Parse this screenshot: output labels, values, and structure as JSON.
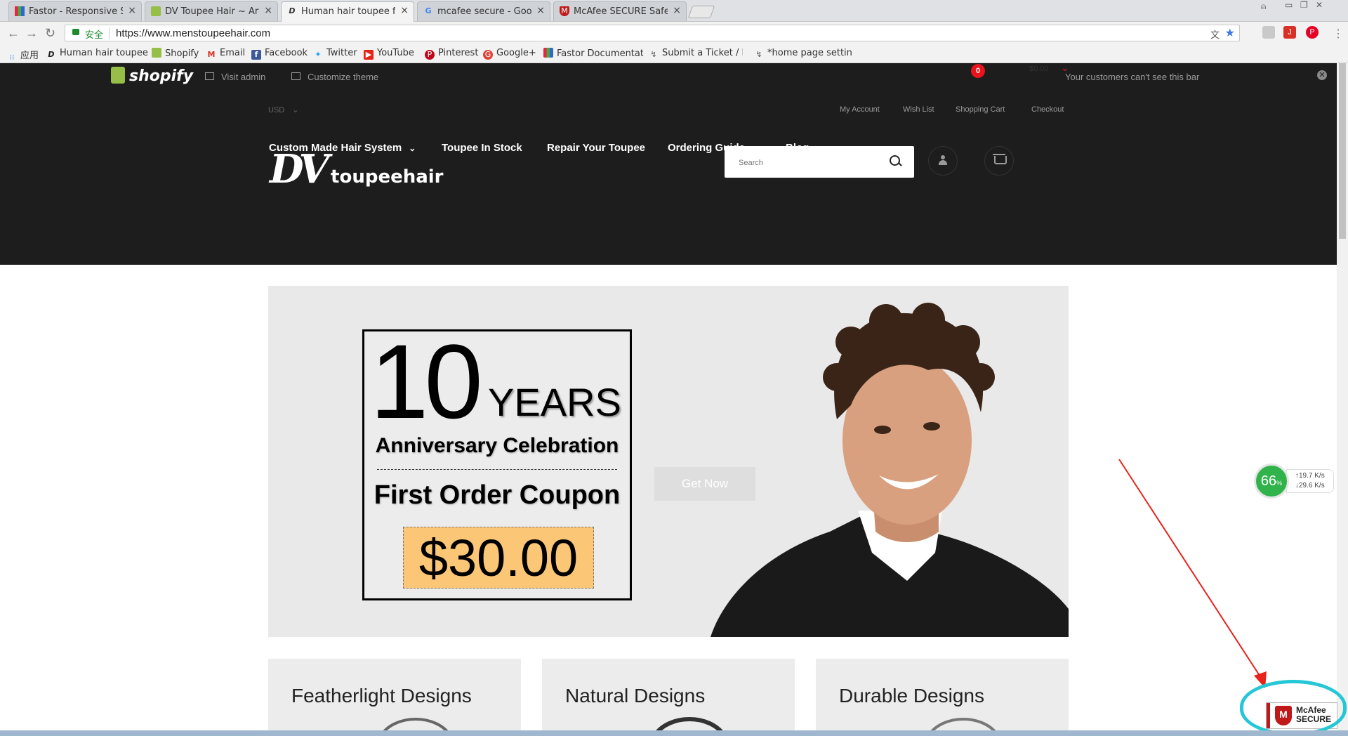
{
  "browser": {
    "tabs": [
      {
        "title": "Fastor - Responsive Sh",
        "icon": "fastor-icon"
      },
      {
        "title": "DV Toupee Hair ~ Arti",
        "icon": "shopify-icon"
      },
      {
        "title": "Human hair toupee for",
        "icon": "dv-icon"
      },
      {
        "title": "mcafee secure - Googl",
        "icon": "google-icon"
      },
      {
        "title": "McAfee SECURE Safe B",
        "icon": "mcafee-icon"
      }
    ],
    "security_label": "安全",
    "url": "https://www.menstoupeehair.com",
    "bookmarks": [
      {
        "label": "应用",
        "icon": "apps-icon"
      },
      {
        "label": "Human hair toupee",
        "icon": "dv-icon"
      },
      {
        "label": "Shopify",
        "icon": "shopify-icon"
      },
      {
        "label": "Email",
        "icon": "gmail-icon"
      },
      {
        "label": "Facebook",
        "icon": "facebook-icon"
      },
      {
        "label": "Twitter",
        "icon": "twitter-icon"
      },
      {
        "label": "YouTube",
        "icon": "youtube-icon"
      },
      {
        "label": "Pinterest",
        "icon": "pinterest-icon"
      },
      {
        "label": "Google+",
        "icon": "googleplus-icon"
      },
      {
        "label": "Fastor Documentati",
        "icon": "fastor-icon"
      },
      {
        "label": "Submit a Ticket / Rc",
        "icon": "ticket-icon"
      },
      {
        "label": "*home page setting",
        "icon": "ticket-icon"
      }
    ]
  },
  "shopify_bar": {
    "logo": "shopify",
    "visit_admin": "Visit admin",
    "customize_theme": "Customize theme",
    "notice": "Your customers can't see this bar"
  },
  "header": {
    "currency": "USD",
    "top_links": [
      "My Account",
      "Wish List",
      "Shopping Cart",
      "Checkout"
    ],
    "logo_mark": "DV",
    "logo_text": "toupeehair",
    "search_placeholder": "Search",
    "cart_count": "0",
    "cart_total": "$0.00"
  },
  "menu": [
    {
      "label": "Custom Made Hair System",
      "dropdown": true
    },
    {
      "label": "Toupee In Stock",
      "dropdown": false
    },
    {
      "label": "Repair Your Toupee",
      "dropdown": false
    },
    {
      "label": "Ordering Guide",
      "dropdown": true
    },
    {
      "label": "Blog",
      "dropdown": false
    }
  ],
  "banner": {
    "big_number": "10",
    "years": "YEARS",
    "anniversary": "Anniversary Celebration",
    "first_order": "First Order Coupon",
    "amount": "$30.00",
    "cta": "Get Now"
  },
  "features": [
    {
      "title": "Featherlight Designs"
    },
    {
      "title": "Natural Designs"
    },
    {
      "title": "Durable Designs"
    }
  ],
  "speed_widget": {
    "percent": "66",
    "percent_unit": "%",
    "up": "19.7 K/s",
    "down": "29.6 K/s"
  },
  "mcafee_badge": {
    "line1": "McAfee",
    "line2": "SECURE"
  },
  "colors": {
    "header_bg": "#1d1d1d",
    "accent_red": "#e8131b",
    "coupon_bg": "#fbc675",
    "highlight_cyan": "#25c7d6",
    "shopify_green": "#95bf47"
  }
}
